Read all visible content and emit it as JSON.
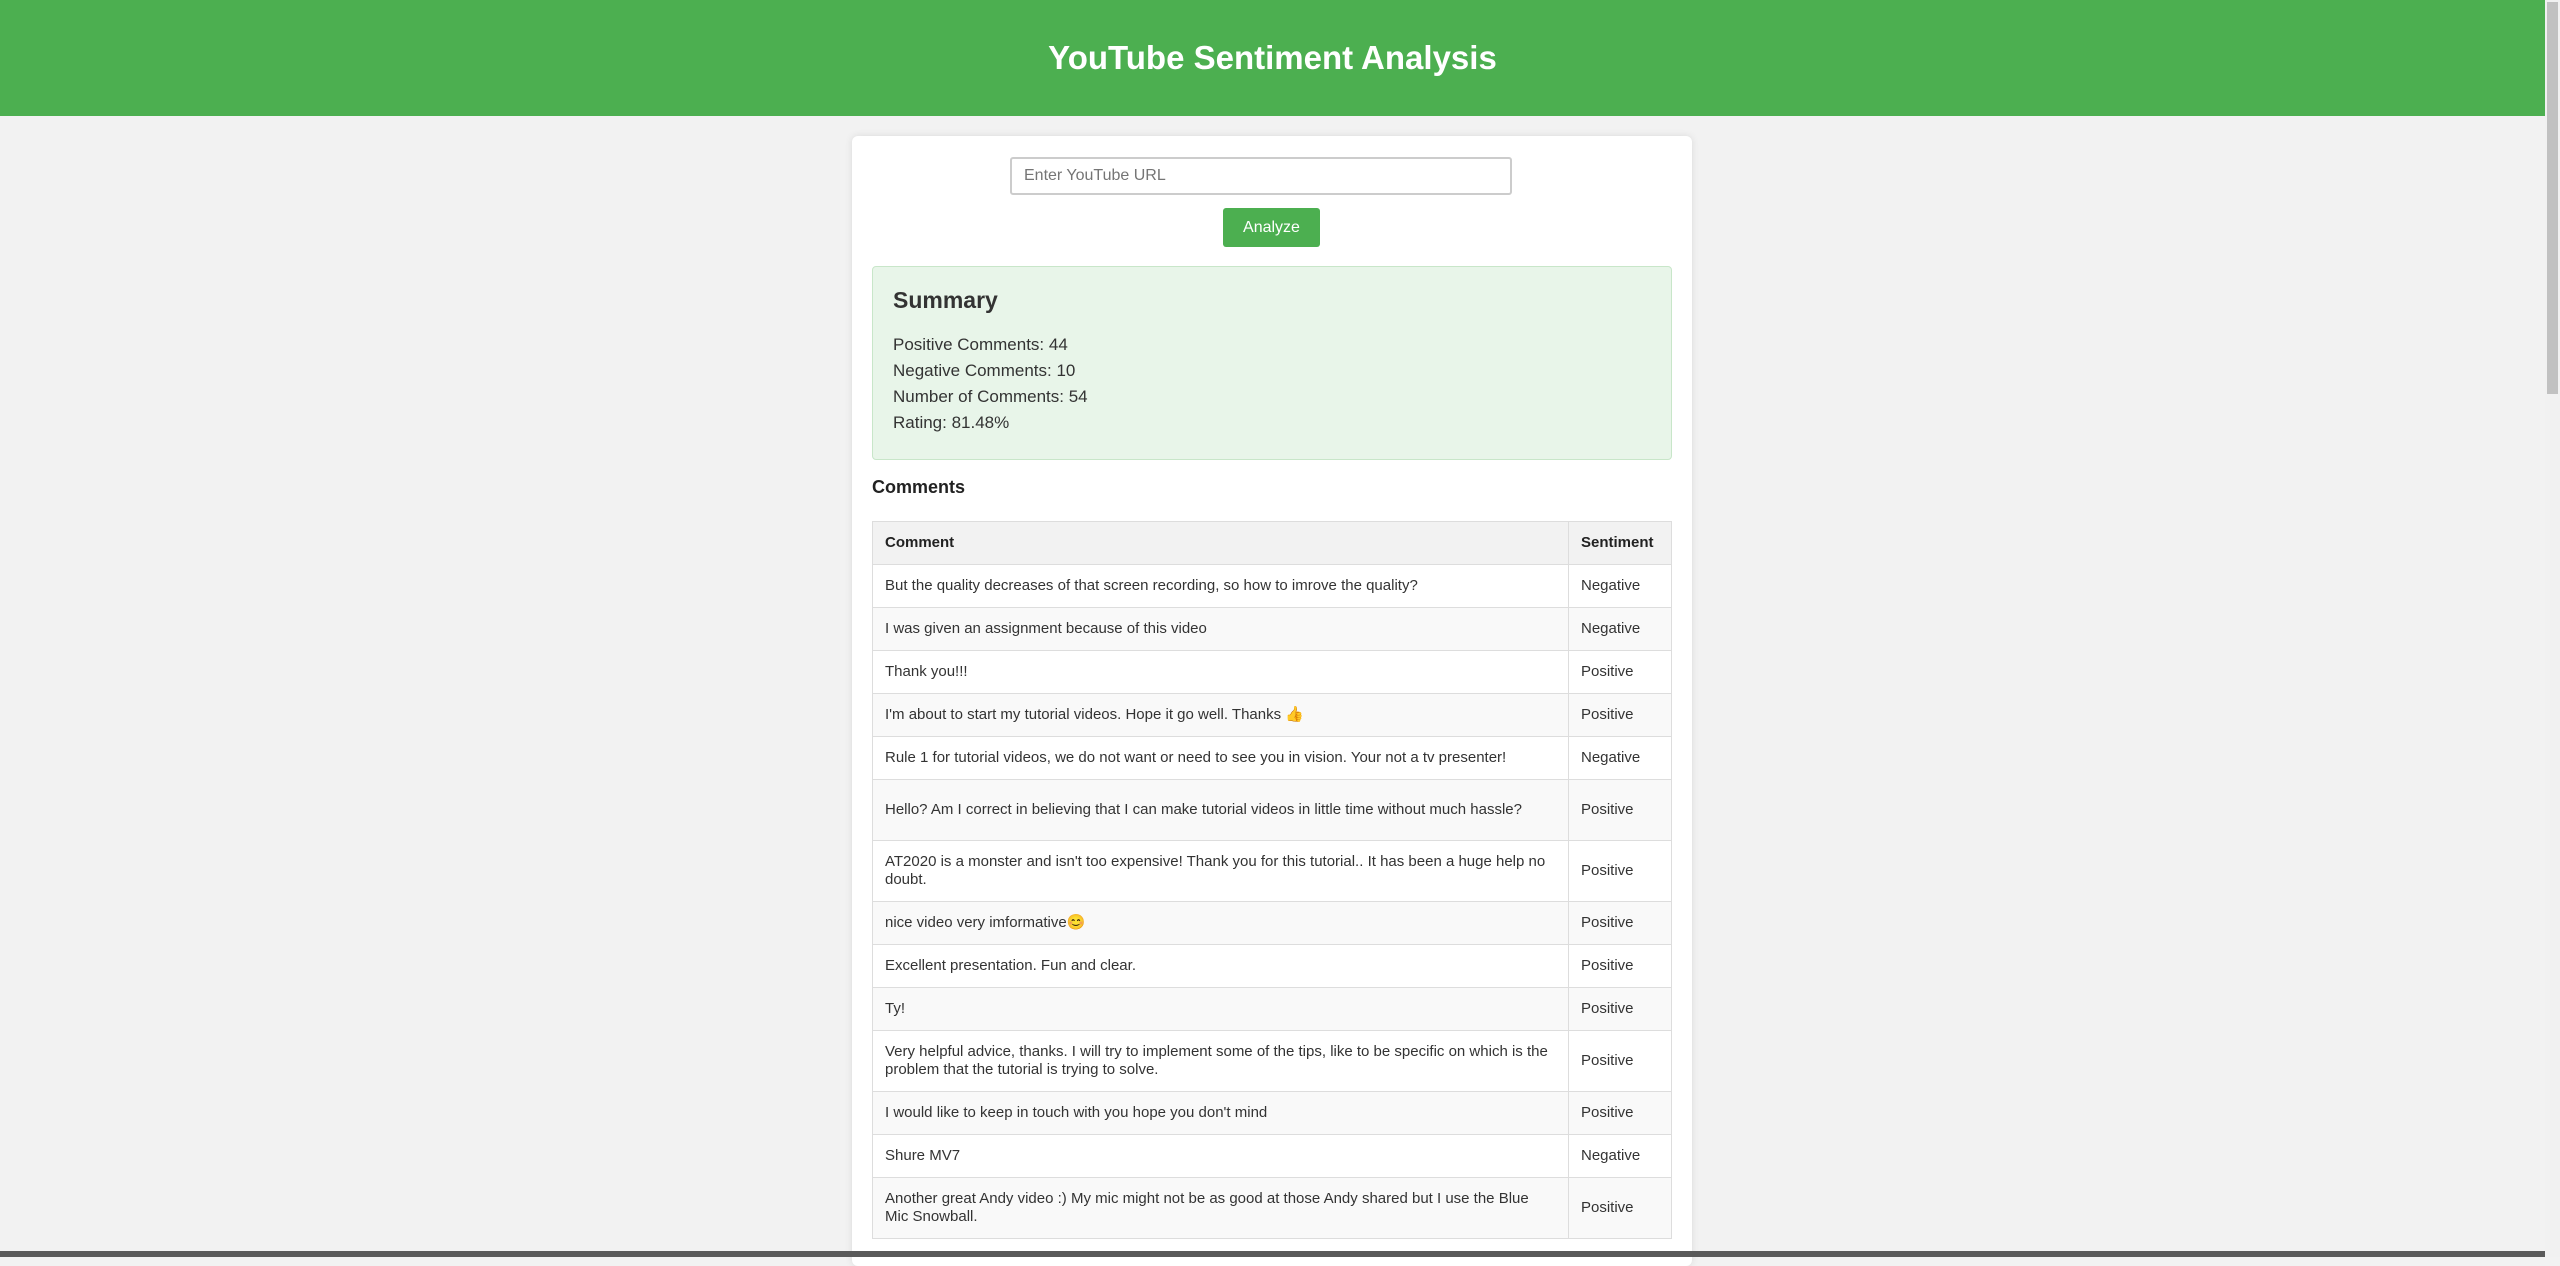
{
  "header": {
    "title": "YouTube Sentiment Analysis",
    "color": "#4caf50"
  },
  "form": {
    "url_placeholder": "Enter YouTube URL",
    "url_value": "",
    "analyze_label": "Analyze"
  },
  "summary": {
    "title": "Summary",
    "positive": "Positive Comments: 44",
    "negative": "Negative Comments: 10",
    "total": "Number of Comments: 54",
    "rating": "Rating: 81.48%"
  },
  "comments": {
    "title": "Comments",
    "headers": [
      "Comment",
      "Sentiment"
    ],
    "rows": [
      {
        "comment": "But the quality decreases of that screen recording, so how to imrove the quality?",
        "sentiment": "Negative"
      },
      {
        "comment": "I was given an assignment because of this video",
        "sentiment": "Negative"
      },
      {
        "comment": "Thank you!!!",
        "sentiment": "Positive"
      },
      {
        "comment": "I'm about to start my tutorial videos. Hope it go well. Thanks 👍",
        "sentiment": "Positive"
      },
      {
        "comment": "Rule 1 for tutorial videos, we do not want or need to see you in vision. Your not a tv presenter!",
        "sentiment": "Negative"
      },
      {
        "comment": "Hello? Am I correct in believing that I can make tutorial videos in little time without much hassle?",
        "sentiment": "Positive"
      },
      {
        "comment": "AT2020 is a monster and isn't too expensive! Thank you for this tutorial.. It has been a huge help no doubt.",
        "sentiment": "Positive"
      },
      {
        "comment": "nice video very imformative😊",
        "sentiment": "Positive"
      },
      {
        "comment": "Excellent presentation. Fun and clear.",
        "sentiment": "Positive"
      },
      {
        "comment": "Ty!",
        "sentiment": "Positive"
      },
      {
        "comment": "Very helpful advice, thanks. I will try to implement some of the tips, like to be specific on which is the problem that the tutorial is trying to solve.",
        "sentiment": "Positive"
      },
      {
        "comment": "I would like to keep in touch with you hope you don't mind",
        "sentiment": "Positive"
      },
      {
        "comment": "Shure MV7",
        "sentiment": "Negative"
      },
      {
        "comment": "Another great Andy video :) My mic might not be as good at those Andy shared but I use the Blue Mic Snowball.",
        "sentiment": "Positive"
      }
    ]
  }
}
